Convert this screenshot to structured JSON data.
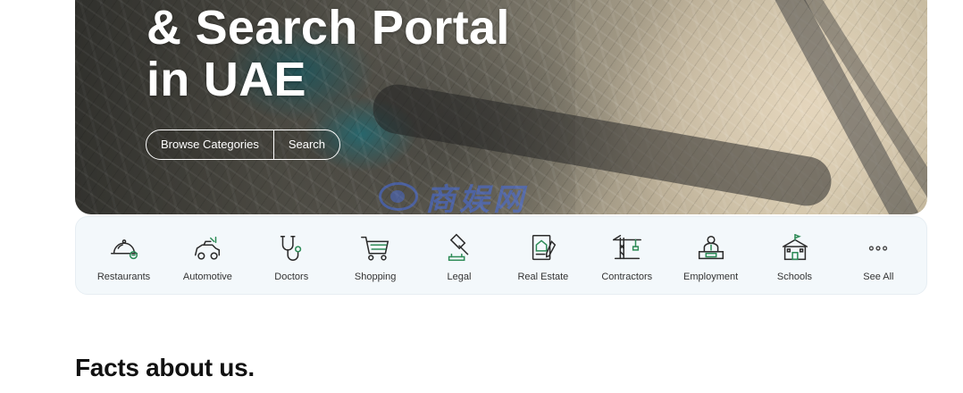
{
  "hero": {
    "title_line_1": "& Search Portal",
    "title_line_2": "in UAE",
    "browse_label": "Browse Categories",
    "search_label": "Search",
    "watermark_text": "商娱网"
  },
  "categories": [
    {
      "label": "Restaurants",
      "icon": "restaurant-cloche-icon"
    },
    {
      "label": "Automotive",
      "icon": "car-icon"
    },
    {
      "label": "Doctors",
      "icon": "stethoscope-icon"
    },
    {
      "label": "Shopping",
      "icon": "shopping-cart-icon"
    },
    {
      "label": "Legal",
      "icon": "gavel-icon"
    },
    {
      "label": "Real Estate",
      "icon": "house-document-icon"
    },
    {
      "label": "Contractors",
      "icon": "crane-icon"
    },
    {
      "label": "Employment",
      "icon": "worker-desk-icon"
    },
    {
      "label": "Schools",
      "icon": "school-building-icon"
    },
    {
      "label": "See All",
      "icon": "more-dots-icon"
    }
  ],
  "facts": {
    "title": "Facts about us."
  },
  "colors": {
    "icon_stroke": "#2b2b2b",
    "icon_accent": "#2e8b57",
    "strip_background": "#f3f8fb"
  }
}
